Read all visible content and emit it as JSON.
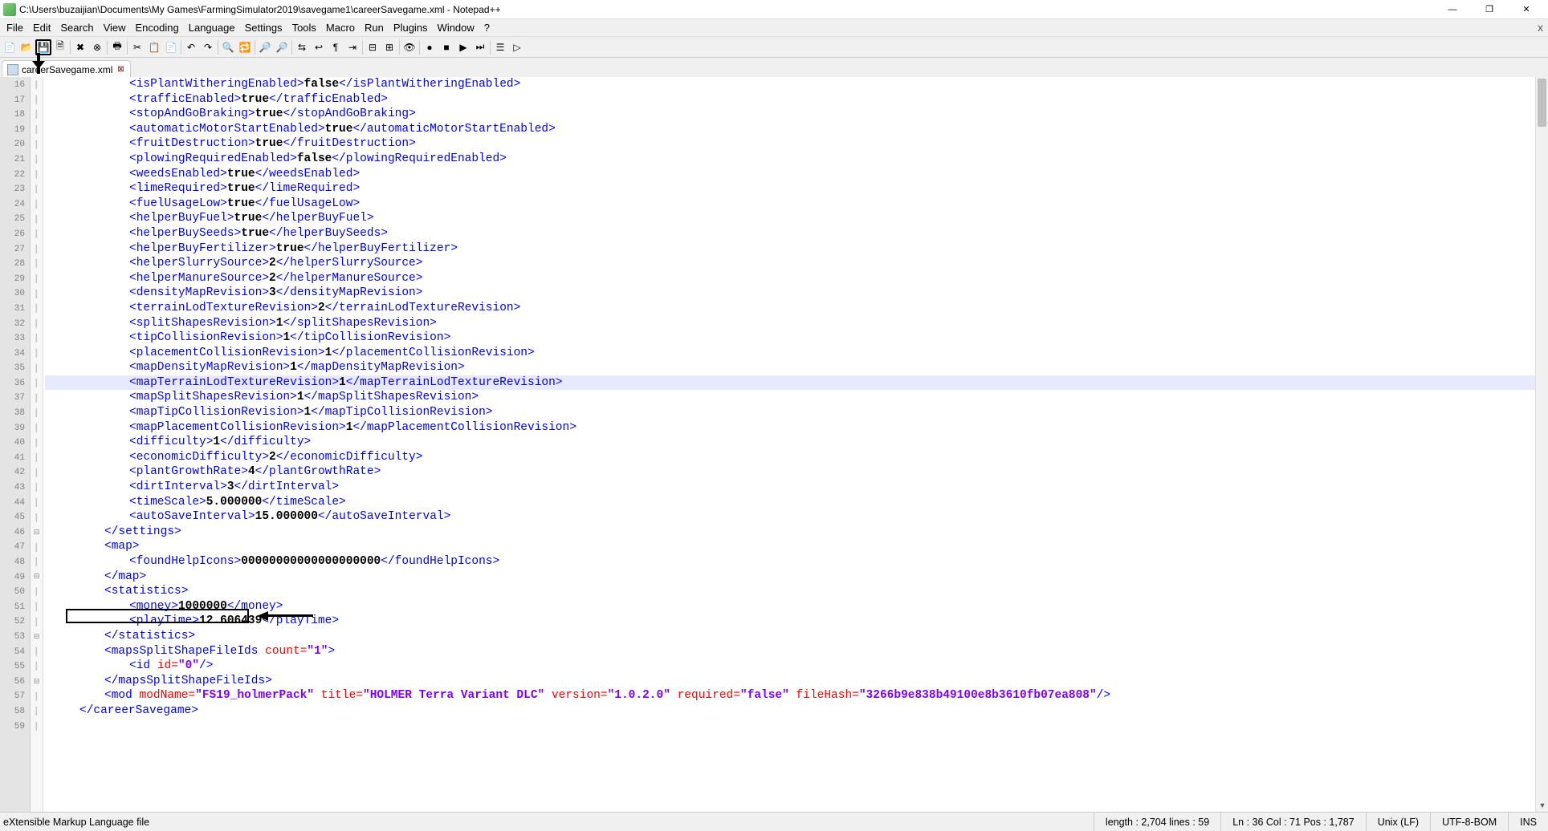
{
  "window": {
    "title": "C:\\Users\\buzaijian\\Documents\\My Games\\FarmingSimulator2019\\savegame1\\careerSavegame.xml - Notepad++"
  },
  "menu": [
    "File",
    "Edit",
    "Search",
    "View",
    "Encoding",
    "Language",
    "Settings",
    "Tools",
    "Macro",
    "Run",
    "Plugins",
    "Window",
    "?"
  ],
  "tab": {
    "label": "careerSavegame.xml"
  },
  "lines": {
    "start": 16,
    "hl": 36,
    "fold_minus": [
      46,
      49,
      53,
      56
    ],
    "rows": [
      {
        "n": 16,
        "cls": "ind2",
        "seg": [
          [
            "tag",
            "<isPlantWitheringEnabled>"
          ],
          [
            "val",
            "false"
          ],
          [
            "tag",
            "</isPlantWitheringEnabled>"
          ]
        ]
      },
      {
        "n": 17,
        "cls": "ind2",
        "seg": [
          [
            "tag",
            "<trafficEnabled>"
          ],
          [
            "val",
            "true"
          ],
          [
            "tag",
            "</trafficEnabled>"
          ]
        ]
      },
      {
        "n": 18,
        "cls": "ind2",
        "seg": [
          [
            "tag",
            "<stopAndGoBraking>"
          ],
          [
            "val",
            "true"
          ],
          [
            "tag",
            "</stopAndGoBraking>"
          ]
        ]
      },
      {
        "n": 19,
        "cls": "ind2",
        "seg": [
          [
            "tag",
            "<automaticMotorStartEnabled>"
          ],
          [
            "val",
            "true"
          ],
          [
            "tag",
            "</automaticMotorStartEnabled>"
          ]
        ]
      },
      {
        "n": 20,
        "cls": "ind2",
        "seg": [
          [
            "tag",
            "<fruitDestruction>"
          ],
          [
            "val",
            "true"
          ],
          [
            "tag",
            "</fruitDestruction>"
          ]
        ]
      },
      {
        "n": 21,
        "cls": "ind2",
        "seg": [
          [
            "tag",
            "<plowingRequiredEnabled>"
          ],
          [
            "val",
            "false"
          ],
          [
            "tag",
            "</plowingRequiredEnabled>"
          ]
        ]
      },
      {
        "n": 22,
        "cls": "ind2",
        "seg": [
          [
            "tag",
            "<weedsEnabled>"
          ],
          [
            "val",
            "true"
          ],
          [
            "tag",
            "</weedsEnabled>"
          ]
        ]
      },
      {
        "n": 23,
        "cls": "ind2",
        "seg": [
          [
            "tag",
            "<limeRequired>"
          ],
          [
            "val",
            "true"
          ],
          [
            "tag",
            "</limeRequired>"
          ]
        ]
      },
      {
        "n": 24,
        "cls": "ind2",
        "seg": [
          [
            "tag",
            "<fuelUsageLow>"
          ],
          [
            "val",
            "true"
          ],
          [
            "tag",
            "</fuelUsageLow>"
          ]
        ]
      },
      {
        "n": 25,
        "cls": "ind2",
        "seg": [
          [
            "tag",
            "<helperBuyFuel>"
          ],
          [
            "val",
            "true"
          ],
          [
            "tag",
            "</helperBuyFuel>"
          ]
        ]
      },
      {
        "n": 26,
        "cls": "ind2",
        "seg": [
          [
            "tag",
            "<helperBuySeeds>"
          ],
          [
            "val",
            "true"
          ],
          [
            "tag",
            "</helperBuySeeds>"
          ]
        ]
      },
      {
        "n": 27,
        "cls": "ind2",
        "seg": [
          [
            "tag",
            "<helperBuyFertilizer>"
          ],
          [
            "val",
            "true"
          ],
          [
            "tag",
            "</helperBuyFertilizer>"
          ]
        ]
      },
      {
        "n": 28,
        "cls": "ind2",
        "seg": [
          [
            "tag",
            "<helperSlurrySource>"
          ],
          [
            "val",
            "2"
          ],
          [
            "tag",
            "</helperSlurrySource>"
          ]
        ]
      },
      {
        "n": 29,
        "cls": "ind2",
        "seg": [
          [
            "tag",
            "<helperManureSource>"
          ],
          [
            "val",
            "2"
          ],
          [
            "tag",
            "</helperManureSource>"
          ]
        ]
      },
      {
        "n": 30,
        "cls": "ind2",
        "seg": [
          [
            "tag",
            "<densityMapRevision>"
          ],
          [
            "val",
            "3"
          ],
          [
            "tag",
            "</densityMapRevision>"
          ]
        ]
      },
      {
        "n": 31,
        "cls": "ind2",
        "seg": [
          [
            "tag",
            "<terrainLodTextureRevision>"
          ],
          [
            "val",
            "2"
          ],
          [
            "tag",
            "</terrainLodTextureRevision>"
          ]
        ]
      },
      {
        "n": 32,
        "cls": "ind2",
        "seg": [
          [
            "tag",
            "<splitShapesRevision>"
          ],
          [
            "val",
            "1"
          ],
          [
            "tag",
            "</splitShapesRevision>"
          ]
        ]
      },
      {
        "n": 33,
        "cls": "ind2",
        "seg": [
          [
            "tag",
            "<tipCollisionRevision>"
          ],
          [
            "val",
            "1"
          ],
          [
            "tag",
            "</tipCollisionRevision>"
          ]
        ]
      },
      {
        "n": 34,
        "cls": "ind2",
        "seg": [
          [
            "tag",
            "<placementCollisionRevision>"
          ],
          [
            "val",
            "1"
          ],
          [
            "tag",
            "</placementCollisionRevision>"
          ]
        ]
      },
      {
        "n": 35,
        "cls": "ind2",
        "seg": [
          [
            "tag",
            "<mapDensityMapRevision>"
          ],
          [
            "val",
            "1"
          ],
          [
            "tag",
            "</mapDensityMapRevision>"
          ]
        ]
      },
      {
        "n": 36,
        "cls": "ind2",
        "seg": [
          [
            "tag",
            "<mapTerrainLodTextureRevision>"
          ],
          [
            "val",
            "1"
          ],
          [
            "tag",
            "</mapTerrainLodTextureRevision>"
          ]
        ]
      },
      {
        "n": 37,
        "cls": "ind2",
        "seg": [
          [
            "tag",
            "<mapSplitShapesRevision>"
          ],
          [
            "val",
            "1"
          ],
          [
            "tag",
            "</mapSplitShapesRevision>"
          ]
        ]
      },
      {
        "n": 38,
        "cls": "ind2",
        "seg": [
          [
            "tag",
            "<mapTipCollisionRevision>"
          ],
          [
            "val",
            "1"
          ],
          [
            "tag",
            "</mapTipCollisionRevision>"
          ]
        ]
      },
      {
        "n": 39,
        "cls": "ind2",
        "seg": [
          [
            "tag",
            "<mapPlacementCollisionRevision>"
          ],
          [
            "val",
            "1"
          ],
          [
            "tag",
            "</mapPlacementCollisionRevision>"
          ]
        ]
      },
      {
        "n": 40,
        "cls": "ind2",
        "seg": [
          [
            "tag",
            "<difficulty>"
          ],
          [
            "val",
            "1"
          ],
          [
            "tag",
            "</difficulty>"
          ]
        ]
      },
      {
        "n": 41,
        "cls": "ind2",
        "seg": [
          [
            "tag",
            "<economicDifficulty>"
          ],
          [
            "val",
            "2"
          ],
          [
            "tag",
            "</economicDifficulty>"
          ]
        ]
      },
      {
        "n": 42,
        "cls": "ind2",
        "seg": [
          [
            "tag",
            "<plantGrowthRate>"
          ],
          [
            "val",
            "4"
          ],
          [
            "tag",
            "</plantGrowthRate>"
          ]
        ]
      },
      {
        "n": 43,
        "cls": "ind2",
        "seg": [
          [
            "tag",
            "<dirtInterval>"
          ],
          [
            "val",
            "3"
          ],
          [
            "tag",
            "</dirtInterval>"
          ]
        ]
      },
      {
        "n": 44,
        "cls": "ind2",
        "seg": [
          [
            "tag",
            "<timeScale>"
          ],
          [
            "val",
            "5.000000"
          ],
          [
            "tag",
            "</timeScale>"
          ]
        ]
      },
      {
        "n": 45,
        "cls": "ind2",
        "seg": [
          [
            "tag",
            "<autoSaveInterval>"
          ],
          [
            "val",
            "15.000000"
          ],
          [
            "tag",
            "</autoSaveInterval>"
          ]
        ]
      },
      {
        "n": 46,
        "cls": "ind1",
        "seg": [
          [
            "tag",
            "</settings>"
          ]
        ]
      },
      {
        "n": 47,
        "cls": "ind1",
        "seg": [
          [
            "tag",
            "<map>"
          ]
        ]
      },
      {
        "n": 48,
        "cls": "ind2",
        "seg": [
          [
            "tag",
            "<foundHelpIcons>"
          ],
          [
            "val",
            "00000000000000000000"
          ],
          [
            "tag",
            "</foundHelpIcons>"
          ]
        ]
      },
      {
        "n": 49,
        "cls": "ind1",
        "seg": [
          [
            "tag",
            "</map>"
          ]
        ]
      },
      {
        "n": 50,
        "cls": "ind1",
        "seg": [
          [
            "tag",
            "<statistics>"
          ]
        ]
      },
      {
        "n": 51,
        "cls": "ind2",
        "seg": [
          [
            "tag",
            "<money>"
          ],
          [
            "val",
            "1000000"
          ],
          [
            "tag",
            "</money>"
          ]
        ]
      },
      {
        "n": 52,
        "cls": "ind2",
        "seg": [
          [
            "tag",
            "<playTime>"
          ],
          [
            "val",
            "12.606439"
          ],
          [
            "tag",
            "</playTime>"
          ]
        ]
      },
      {
        "n": 53,
        "cls": "ind1",
        "seg": [
          [
            "tag",
            "</statistics>"
          ]
        ]
      },
      {
        "n": 54,
        "cls": "ind1",
        "seg": [
          [
            "tag",
            "<mapsSplitShapeFileIds "
          ],
          [
            "attr",
            "count="
          ],
          [
            "str",
            "\"1\""
          ],
          [
            "tag",
            ">"
          ]
        ]
      },
      {
        "n": 55,
        "cls": "ind2",
        "seg": [
          [
            "tag",
            "<id "
          ],
          [
            "attr",
            "id="
          ],
          [
            "str",
            "\"0\""
          ],
          [
            "tag",
            "/>"
          ]
        ]
      },
      {
        "n": 56,
        "cls": "ind1",
        "seg": [
          [
            "tag",
            "</mapsSplitShapeFileIds>"
          ]
        ]
      },
      {
        "n": 57,
        "cls": "ind1",
        "seg": [
          [
            "tag",
            "<mod "
          ],
          [
            "attr",
            "modName="
          ],
          [
            "str",
            "\"FS19_holmerPack\""
          ],
          [
            "attr",
            " title="
          ],
          [
            "str",
            "\"HOLMER Terra Variant DLC\""
          ],
          [
            "attr",
            " version="
          ],
          [
            "str",
            "\"1.0.2.0\""
          ],
          [
            "attr",
            " required="
          ],
          [
            "str",
            "\"false\""
          ],
          [
            "attr",
            " fileHash="
          ],
          [
            "str",
            "\"3266b9e838b49100e8b3610fb07ea808\""
          ],
          [
            "tag",
            "/>"
          ]
        ]
      },
      {
        "n": 58,
        "cls": "ind0",
        "seg": [
          [
            "tag",
            "</careerSavegame>"
          ]
        ]
      },
      {
        "n": 59,
        "cls": "ind0",
        "seg": []
      }
    ]
  },
  "status": {
    "filetype": "eXtensible Markup Language file",
    "length": "length : 2,704    lines : 59",
    "pos": "Ln : 36    Col : 71    Pos : 1,787",
    "eol": "Unix (LF)",
    "enc": "UTF-8-BOM",
    "ins": "INS"
  },
  "toolbar_icons": [
    "new",
    "open",
    "save",
    "save-all",
    "|",
    "close",
    "close-all",
    "|",
    "print",
    "|",
    "cut",
    "copy",
    "paste",
    "|",
    "undo",
    "redo",
    "|",
    "find",
    "replace",
    "|",
    "zoom-in",
    "zoom-out",
    "|",
    "sync",
    "wrap",
    "all-chars",
    "indent",
    "|",
    "fold",
    "unfold",
    "|",
    "hidden",
    "|",
    "record",
    "stop",
    "play",
    "play-mult",
    "|",
    "macro-list",
    "run"
  ]
}
